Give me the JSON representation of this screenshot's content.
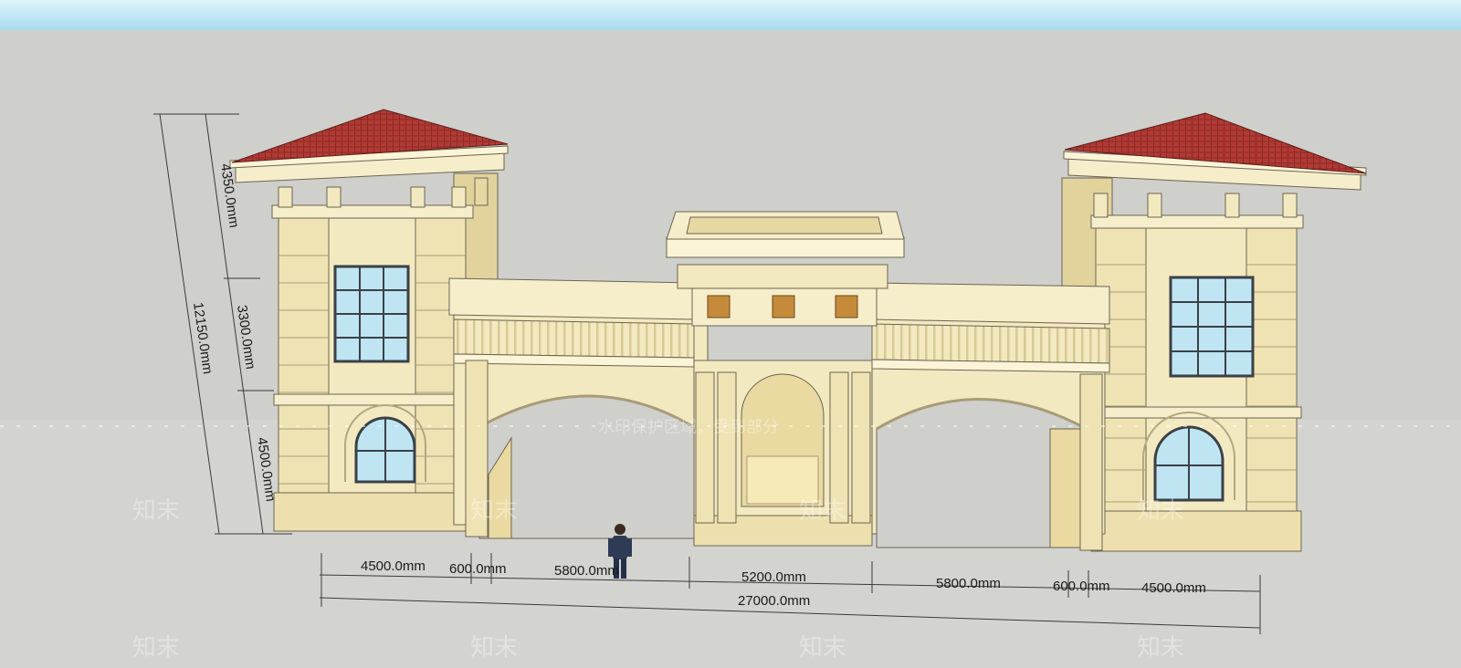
{
  "dimensions": {
    "height_total": "12150.0mm",
    "height_roof": "4350.0mm",
    "height_mid": "3300.0mm",
    "height_base": "4500.0mm",
    "w_left_tower": "4500.0mm",
    "w_left_pier": "600.0mm",
    "w_left_arch": "5800.0mm",
    "w_center": "5200.0mm",
    "w_right_arch": "5800.0mm",
    "w_right_pier": "600.0mm",
    "w_right_tower": "4500.0mm",
    "w_total": "27000.0mm"
  },
  "watermark": {
    "brand": "知末",
    "notice": "水印保护区域，受到部分"
  },
  "colors": {
    "stone": "#f3e9c0",
    "stone_shade": "#e6d7a3",
    "roof": "#b23a34",
    "glass": "#bfe4f2",
    "ground": "#d4d4d1"
  }
}
